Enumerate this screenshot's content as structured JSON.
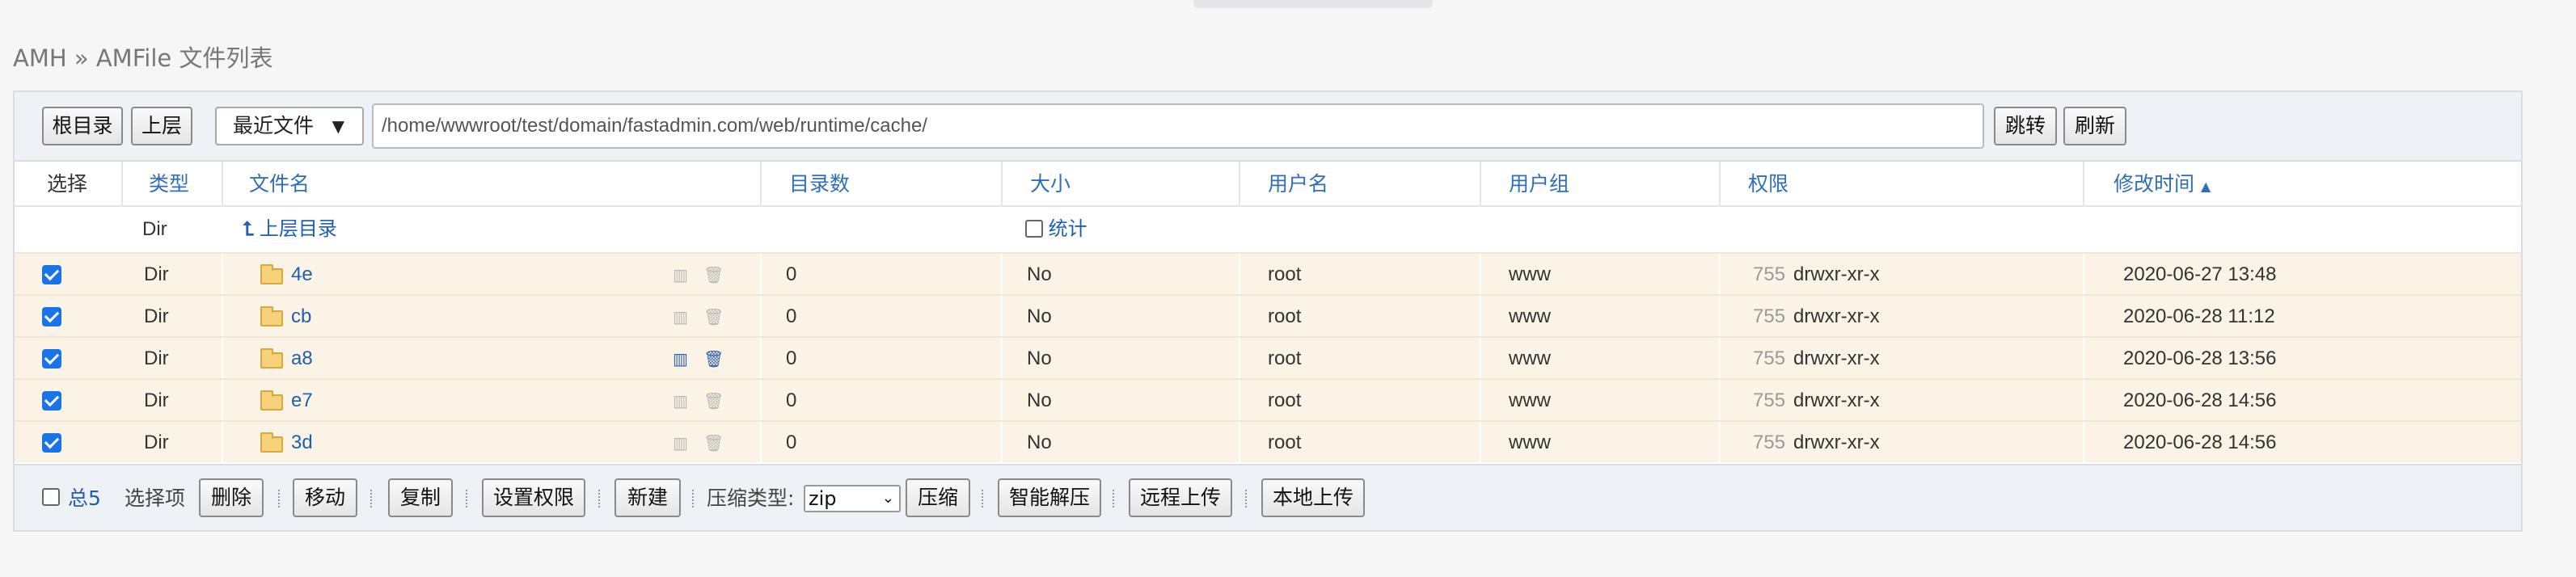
{
  "breadcrumb": "AMH » AMFile 文件列表",
  "toolbar": {
    "root_label": "根目录",
    "up_label": "上层",
    "recent_label": "最近文件",
    "path": "/home/wwwroot/test/domain/fastadmin.com/web/runtime/cache/",
    "go_label": "跳转",
    "refresh_label": "刷新"
  },
  "columns": {
    "select": "选择",
    "type": "类型",
    "name": "文件名",
    "dirs": "目录数",
    "size": "大小",
    "user": "用户名",
    "group": "用户组",
    "perm": "权限",
    "mtime": "修改时间"
  },
  "parent_row": {
    "type": "Dir",
    "name": "上层目录",
    "stat_label": "统计"
  },
  "rows": [
    {
      "checked": true,
      "type": "Dir",
      "name": "4e",
      "dirs": "0",
      "size": "No",
      "user": "root",
      "group": "www",
      "perm_num": "755",
      "perm": "drwxr-xr-x",
      "mtime": "2020-06-27 13:48"
    },
    {
      "checked": true,
      "type": "Dir",
      "name": "cb",
      "dirs": "0",
      "size": "No",
      "user": "root",
      "group": "www",
      "perm_num": "755",
      "perm": "drwxr-xr-x",
      "mtime": "2020-06-28 11:12"
    },
    {
      "checked": true,
      "type": "Dir",
      "name": "a8",
      "dirs": "0",
      "size": "No",
      "user": "root",
      "group": "www",
      "perm_num": "755",
      "perm": "drwxr-xr-x",
      "mtime": "2020-06-28 13:56"
    },
    {
      "checked": true,
      "type": "Dir",
      "name": "e7",
      "dirs": "0",
      "size": "No",
      "user": "root",
      "group": "www",
      "perm_num": "755",
      "perm": "drwxr-xr-x",
      "mtime": "2020-06-28 14:56"
    },
    {
      "checked": true,
      "type": "Dir",
      "name": "3d",
      "dirs": "0",
      "size": "No",
      "user": "root",
      "group": "www",
      "perm_num": "755",
      "perm": "drwxr-xr-x",
      "mtime": "2020-06-28 14:56"
    }
  ],
  "footer": {
    "total_label": "总5",
    "selected_label": "选择项",
    "delete_label": "删除",
    "move_label": "移动",
    "copy_label": "复制",
    "perm_label": "设置权限",
    "new_label": "新建",
    "compress_type_label": "压缩类型:",
    "compress_type_value": "zip",
    "compress_label": "压缩",
    "extract_label": "智能解压",
    "remote_upload_label": "远程上传",
    "local_upload_label": "本地上传"
  },
  "colors": {
    "link": "#1e5fb0",
    "row_bg": "#fbf4e6",
    "toolbar_bg": "#eef2f6"
  }
}
